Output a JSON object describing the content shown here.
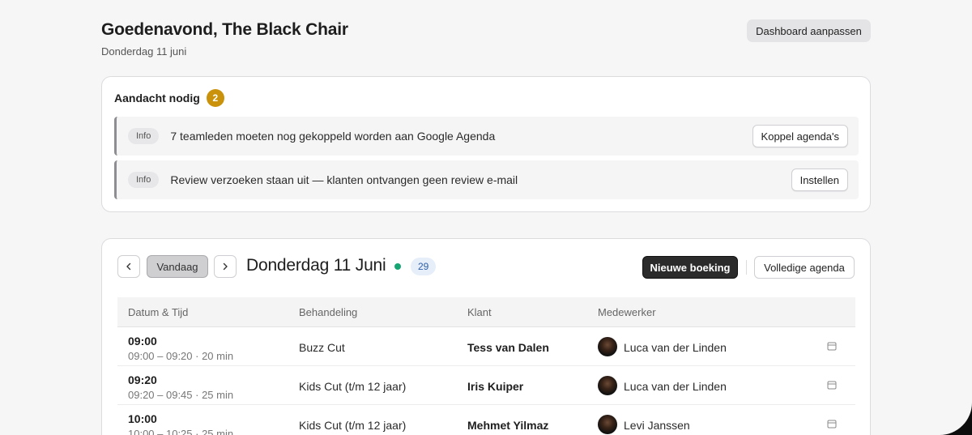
{
  "header": {
    "greeting": "Goedenavond, The Black Chair",
    "date": "Donderdag 11 juni",
    "customize_label": "Dashboard aanpassen"
  },
  "attention": {
    "title": "Aandacht nodig",
    "count": "2",
    "alerts": [
      {
        "tag": "Info",
        "message": "7 teamleden moeten nog gekoppeld worden aan Google Agenda",
        "action": "Koppel agenda's"
      },
      {
        "tag": "Info",
        "message": "Review verzoeken staan uit — klanten ontvangen geen review e-mail",
        "action": "Instellen"
      }
    ]
  },
  "agenda": {
    "today_label": "Vandaag",
    "day_title": "Donderdag 11 Juni",
    "count": "29",
    "new_booking_label": "Nieuwe boeking",
    "full_agenda_label": "Volledige agenda",
    "columns": [
      "Datum & Tijd",
      "Behandeling",
      "Klant",
      "Medewerker"
    ],
    "rows": [
      {
        "time": "09:00",
        "range": "09:00 – 09:20 · 20 min",
        "treatment": "Buzz Cut",
        "client": "Tess van Dalen",
        "staff": "Luca van der Linden"
      },
      {
        "time": "09:20",
        "range": "09:20 – 09:45 · 25 min",
        "treatment": "Kids Cut (t/m 12 jaar)",
        "client": "Iris Kuiper",
        "staff": "Luca van der Linden"
      },
      {
        "time": "10:00",
        "range": "10:00 – 10:25 · 25 min",
        "treatment": "Kids Cut (t/m 12 jaar)",
        "client": "Mehmet Yilmaz",
        "staff": "Levi Janssen"
      }
    ]
  },
  "colors": {
    "badge": "#c9920a",
    "status_dot": "#17a673",
    "primary_button": "#2b2b2b"
  }
}
